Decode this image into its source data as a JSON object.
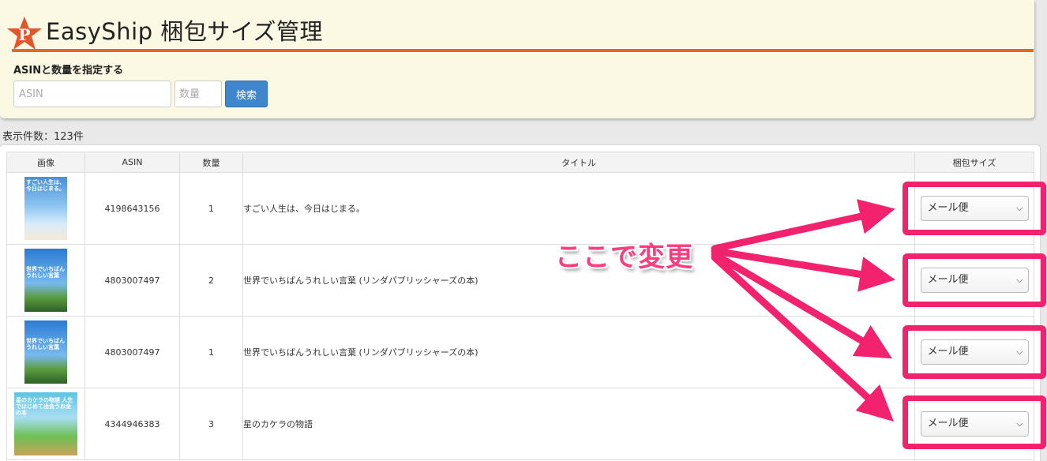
{
  "header": {
    "title": "EasyShip 梱包サイズ管理",
    "logo_letter": "P"
  },
  "form": {
    "label": "ASINと数量を指定する",
    "asin_placeholder": "ASIN",
    "qty_placeholder": "数量",
    "search_button": "検索"
  },
  "result_count": "表示件数：123件",
  "table": {
    "columns": [
      "画像",
      "ASIN",
      "数量",
      "タイトル",
      "梱包サイズ"
    ],
    "rows": [
      {
        "cover": "すごい人生は、今日はじまる。",
        "asin": "4198643156",
        "qty": "1",
        "title": "すごい人生は、今日はじまる。",
        "size": "メール便"
      },
      {
        "cover": "世界でいちばん うれしい言葉",
        "asin": "4803007497",
        "qty": "2",
        "title": "世界でいちばんうれしい言葉 (リンダパブリッシャーズの本)",
        "size": "メール便"
      },
      {
        "cover": "世界でいちばん うれしい言葉",
        "asin": "4803007497",
        "qty": "1",
        "title": "世界でいちばんうれしい言葉 (リンダパブリッシャーズの本)",
        "size": "メール便"
      },
      {
        "cover": "星のカケラの物語 人生ではじめて出会うお金の本",
        "asin": "4344946383",
        "qty": "3",
        "title": "星のカケラの物語",
        "size": "メール便"
      }
    ]
  },
  "annotation": {
    "text": "ここで変更",
    "color": "#f2226e"
  },
  "colors": {
    "accent_orange": "#e56a1c",
    "button_blue": "#3f86cc",
    "panel_bg": "#fbf9e3"
  }
}
